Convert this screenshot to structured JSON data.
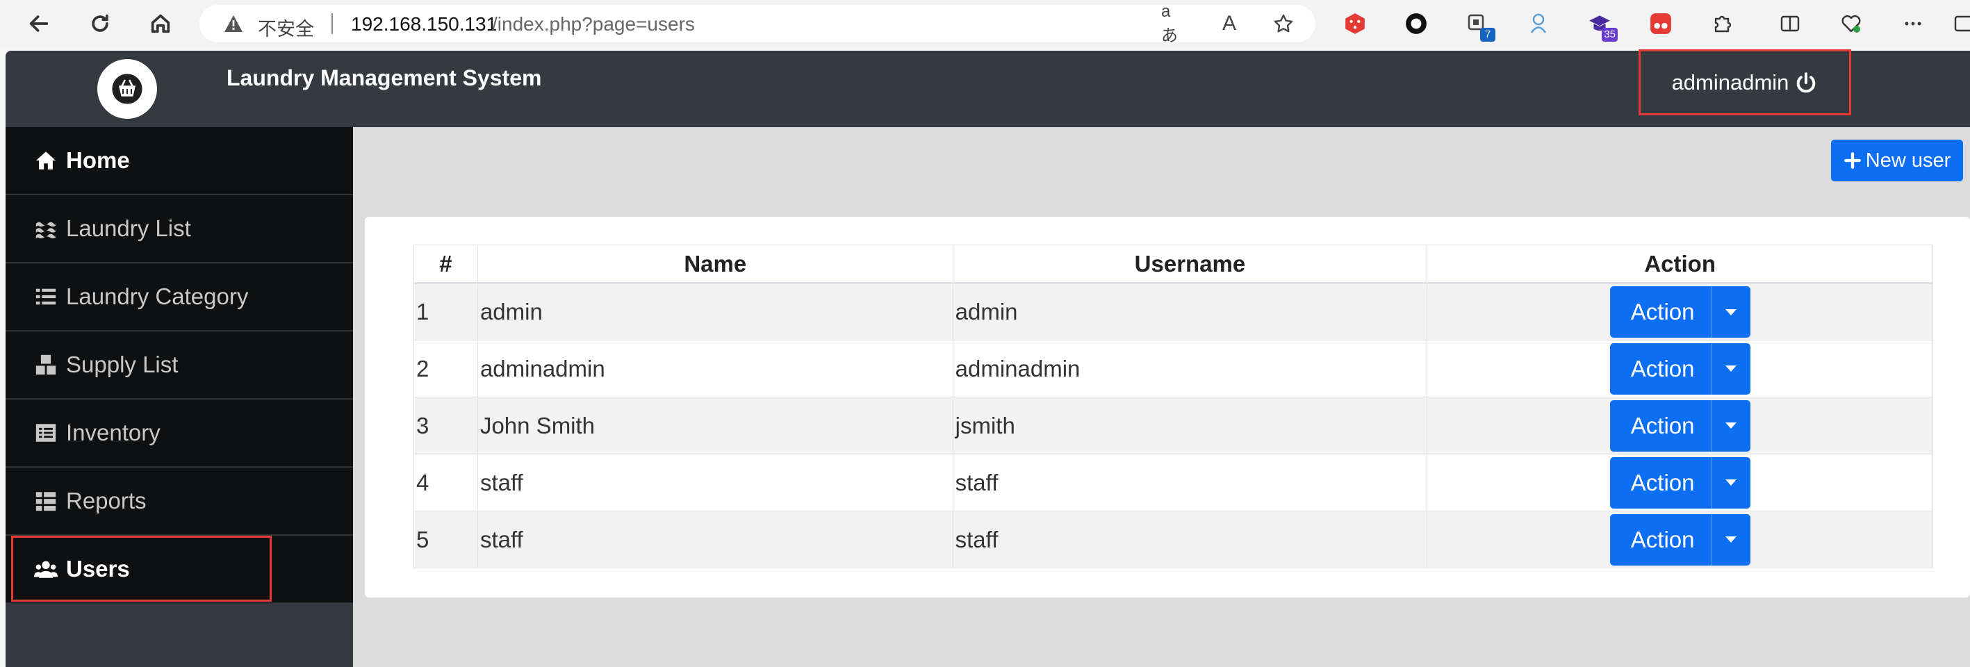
{
  "browser": {
    "insecure_label": "不安全",
    "url_host": "192.168.150.131",
    "url_path": "/index.php?page=users",
    "translate_icon_text": "aあ",
    "read_aloud_icon_text": "A",
    "extensions": [
      {
        "name": "dice-extension-icon",
        "color": "#e53935"
      },
      {
        "name": "circle-extension-icon",
        "color": "#111111"
      },
      {
        "name": "collections-extension-icon",
        "color": "#1565c0",
        "badge": "7"
      },
      {
        "name": "robot-extension-icon",
        "color": "#5aa0d8"
      },
      {
        "name": "graduation-extension-icon",
        "color": "#4a2aa0",
        "badge": "35"
      },
      {
        "name": "red-extension-icon",
        "color": "#e53935"
      }
    ]
  },
  "header": {
    "app_title": "Laundry Management System",
    "username": "adminadmin"
  },
  "sidebar": {
    "items": [
      {
        "label": "Home",
        "icon": "home-icon",
        "active": true
      },
      {
        "label": "Laundry List",
        "icon": "water-icon",
        "active": false
      },
      {
        "label": "Laundry Category",
        "icon": "list-icon",
        "active": false
      },
      {
        "label": "Supply List",
        "icon": "boxes-icon",
        "active": false
      },
      {
        "label": "Inventory",
        "icon": "list-alt-icon",
        "active": false
      },
      {
        "label": "Reports",
        "icon": "th-list-icon",
        "active": false
      },
      {
        "label": "Users",
        "icon": "users-icon",
        "active": true
      }
    ]
  },
  "main": {
    "new_user_label": "New user",
    "table": {
      "headers": [
        "#",
        "Name",
        "Username",
        "Action"
      ],
      "rows": [
        {
          "num": "1",
          "name": "admin",
          "username": "admin",
          "action": "Action"
        },
        {
          "num": "2",
          "name": "adminadmin",
          "username": "adminadmin",
          "action": "Action"
        },
        {
          "num": "3",
          "name": "John Smith",
          "username": "jsmith",
          "action": "Action"
        },
        {
          "num": "4",
          "name": "staff",
          "username": "staff",
          "action": "Action"
        },
        {
          "num": "5",
          "name": "staff",
          "username": "staff",
          "action": "Action"
        }
      ]
    }
  },
  "colors": {
    "header_bg": "#343a40",
    "sidebar_item_bg": "#0e1012",
    "primary": "#0b6ef3",
    "highlight": "#e53935"
  }
}
